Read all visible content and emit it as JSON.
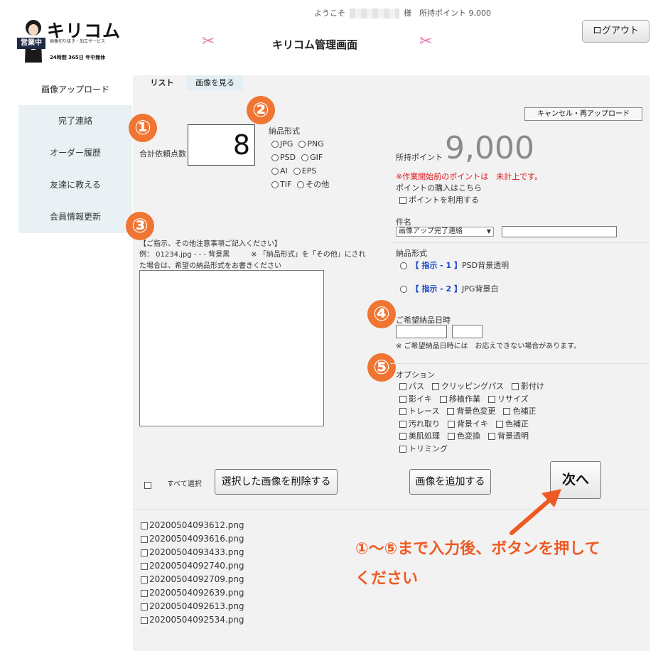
{
  "header": {
    "logo_title": "キリコム",
    "logo_badge": "営業中",
    "logo_subtitle": "画像切り抜き・加工サービス",
    "logo_hours": "24時間 365日 年中無休",
    "welcome_prefix": "ようこそ",
    "welcome_suffix": "様",
    "points_label": "所持ポイント 9,000",
    "admin_title": "キリコム管理画面",
    "logout_label": "ログアウト"
  },
  "sidebar": {
    "active_label": "画像アップロード",
    "items": [
      {
        "label": "完了連絡"
      },
      {
        "label": "オーダー履歴"
      },
      {
        "label": "友達に教える"
      },
      {
        "label": "会員情報更新"
      }
    ]
  },
  "tabs": [
    {
      "label": "リスト"
    },
    {
      "label": "画像を見る"
    }
  ],
  "cancel_button": "キャンセル・再アップロード",
  "annotations": [
    "①",
    "②",
    "③",
    "④",
    "⑤"
  ],
  "count": {
    "label": "合計依頼点数",
    "value": "8"
  },
  "format": {
    "label": "納品形式",
    "options": [
      "JPG",
      "PNG",
      "PSD",
      "GIF",
      "AI",
      "EPS",
      "TIF",
      "その他"
    ]
  },
  "points": {
    "label": "所持ポイント",
    "value": "9,000",
    "notice": "※作業開始前のポイントは　未計上です。",
    "purchase": "ポイントの購入はこちら",
    "use_label": "ポイントを利用する"
  },
  "subject": {
    "label": "件名",
    "selected": "画像アップ完了連絡"
  },
  "delivery": {
    "label": "納品形式",
    "options": [
      {
        "tag": "【 指示 - 1 】",
        "text": "PSD背景透明"
      },
      {
        "tag": "【 指示 - 2 】",
        "text": "JPG背景白"
      }
    ]
  },
  "instructions": {
    "heading": "【ご指示、その他注意事項ご記入ください】",
    "example_line1": "例： 01234.jpg - - - 背景黒　　　※ 「納品形式」を「その他」にされ",
    "example_line2": "た場合は、希望の納品形式をお書きください"
  },
  "due_date": {
    "label": "ご希望納品日時",
    "note": "※ ご希望納品日時には　お応えできない場合があります。"
  },
  "options": {
    "label": "オプション",
    "rows": [
      [
        "パス",
        "クリッピングパス",
        "影付け"
      ],
      [
        "影イキ",
        "移植作業",
        "リサイズ"
      ],
      [
        "トレース",
        "背景色変更",
        "色補正"
      ],
      [
        "汚れ取り",
        "背景イキ",
        "色補正"
      ],
      [
        "美肌処理",
        "色変換",
        "背景透明"
      ],
      [
        "トリミング"
      ]
    ]
  },
  "actions": {
    "select_all": "すべて選択",
    "delete_label": "選択した画像を削除する",
    "add_label": "画像を追加する",
    "next_label": "次へ"
  },
  "files": [
    "20200504093612.png",
    "20200504093616.png",
    "20200504093433.png",
    "20200504092740.png",
    "20200504092709.png",
    "20200504092639.png",
    "20200504092613.png",
    "20200504092534.png"
  ],
  "callout": {
    "line1": "①〜⑤まで入力後、ボタンを押して",
    "line2": "ください"
  },
  "colors": {
    "sidebar_bg": "#e9f1f5",
    "main_bg": "#f2f2f2",
    "annotation": "#f07432",
    "callout": "#ee5a24",
    "notice": "#e0121b",
    "link_blue": "#1a47c9"
  }
}
